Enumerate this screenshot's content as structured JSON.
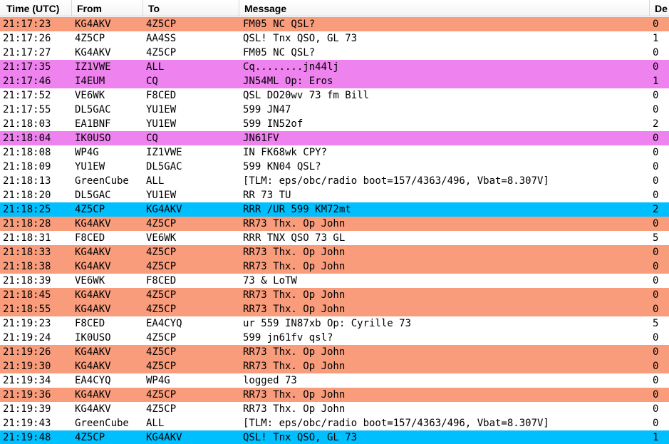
{
  "columns": [
    "Time (UTC)",
    "From",
    "To",
    "Message",
    "De"
  ],
  "colors": {
    "orange": "#f89c7c",
    "purple": "#ee82ee",
    "blue": "#00bfff",
    "white": "#ffffff"
  },
  "rows": [
    {
      "time": "21:17:23",
      "from": "KG4AKV",
      "to": "4Z5CP",
      "message": "FM05 NC QSL?",
      "de": "0",
      "color": "orange"
    },
    {
      "time": "21:17:26",
      "from": "4Z5CP",
      "to": "AA4SS",
      "message": "QSL! Tnx QSO, GL 73",
      "de": "1",
      "color": "white"
    },
    {
      "time": "21:17:27",
      "from": "KG4AKV",
      "to": "4Z5CP",
      "message": "FM05 NC QSL?",
      "de": "0",
      "color": "white"
    },
    {
      "time": "21:17:35",
      "from": "IZ1VWE",
      "to": "ALL",
      "message": "Cq........jn44lj",
      "de": "0",
      "color": "purple"
    },
    {
      "time": "21:17:46",
      "from": "I4EUM",
      "to": "CQ",
      "message": "JN54ML Op: Eros",
      "de": "1",
      "color": "purple"
    },
    {
      "time": "21:17:52",
      "from": "VE6WK",
      "to": "F8CED",
      "message": "QSL DO20wv 73 fm Bill",
      "de": "0",
      "color": "white"
    },
    {
      "time": "21:17:55",
      "from": "DL5GAC",
      "to": "YU1EW",
      "message": "599 JN47",
      "de": "0",
      "color": "white"
    },
    {
      "time": "21:18:03",
      "from": "EA1BNF",
      "to": "YU1EW",
      "message": "599  IN52of",
      "de": "2",
      "color": "white"
    },
    {
      "time": "21:18:04",
      "from": "IK0USO",
      "to": "CQ",
      "message": "JN61FV",
      "de": "0",
      "color": "purple"
    },
    {
      "time": "21:18:08",
      "from": "WP4G",
      "to": "IZ1VWE",
      "message": "IN FK68wk CPY?",
      "de": "0",
      "color": "white"
    },
    {
      "time": "21:18:09",
      "from": "YU1EW",
      "to": "DL5GAC",
      "message": "599 KN04 QSL?",
      "de": "0",
      "color": "white"
    },
    {
      "time": "21:18:13",
      "from": "GreenCube",
      "to": "ALL",
      "message": "[TLM: eps/obc/radio boot=157/4363/496, Vbat=8.307V]",
      "de": "0",
      "color": "white"
    },
    {
      "time": "21:18:20",
      "from": "DL5GAC",
      "to": "YU1EW",
      "message": "RR 73 TU",
      "de": "0",
      "color": "white"
    },
    {
      "time": "21:18:25",
      "from": "4Z5CP",
      "to": "KG4AKV",
      "message": "RRR /UR 599 KM72mt",
      "de": "2",
      "color": "blue"
    },
    {
      "time": "21:18:28",
      "from": "KG4AKV",
      "to": "4Z5CP",
      "message": "RR73 Thx. Op John",
      "de": "0",
      "color": "orange"
    },
    {
      "time": "21:18:31",
      "from": "F8CED",
      "to": "VE6WK",
      "message": "RRR TNX QSO 73 GL",
      "de": "5",
      "color": "white"
    },
    {
      "time": "21:18:33",
      "from": "KG4AKV",
      "to": "4Z5CP",
      "message": "RR73 Thx. Op John",
      "de": "0",
      "color": "orange"
    },
    {
      "time": "21:18:38",
      "from": "KG4AKV",
      "to": "4Z5CP",
      "message": "RR73 Thx. Op John",
      "de": "0",
      "color": "orange"
    },
    {
      "time": "21:18:39",
      "from": "VE6WK",
      "to": "F8CED",
      "message": "73 & LoTW",
      "de": "0",
      "color": "white"
    },
    {
      "time": "21:18:45",
      "from": "KG4AKV",
      "to": "4Z5CP",
      "message": "RR73 Thx. Op John",
      "de": "0",
      "color": "orange"
    },
    {
      "time": "21:18:55",
      "from": "KG4AKV",
      "to": "4Z5CP",
      "message": "RR73 Thx. Op John",
      "de": "0",
      "color": "orange"
    },
    {
      "time": "21:19:23",
      "from": "F8CED",
      "to": "EA4CYQ",
      "message": "ur 559 IN87xb Op: Cyrille 73",
      "de": "5",
      "color": "white"
    },
    {
      "time": "21:19:24",
      "from": "IK0USO",
      "to": "4Z5CP",
      "message": "599 jn61fv qsl?",
      "de": "0",
      "color": "white"
    },
    {
      "time": "21:19:26",
      "from": "KG4AKV",
      "to": "4Z5CP",
      "message": "RR73 Thx. Op John",
      "de": "0",
      "color": "orange"
    },
    {
      "time": "21:19:30",
      "from": "KG4AKV",
      "to": "4Z5CP",
      "message": "RR73 Thx. Op John",
      "de": "0",
      "color": "orange"
    },
    {
      "time": "21:19:34",
      "from": "EA4CYQ",
      "to": "WP4G",
      "message": "logged 73",
      "de": "0",
      "color": "white"
    },
    {
      "time": "21:19:36",
      "from": "KG4AKV",
      "to": "4Z5CP",
      "message": "RR73 Thx. Op John",
      "de": "0",
      "color": "orange"
    },
    {
      "time": "21:19:39",
      "from": "KG4AKV",
      "to": "4Z5CP",
      "message": "RR73 Thx. Op John",
      "de": "0",
      "color": "white"
    },
    {
      "time": "21:19:43",
      "from": "GreenCube",
      "to": "ALL",
      "message": "[TLM: eps/obc/radio boot=157/4363/496, Vbat=8.307V]",
      "de": "0",
      "color": "white"
    },
    {
      "time": "21:19:48",
      "from": "4Z5CP",
      "to": "KG4AKV",
      "message": "QSL! Tnx QSO, GL 73",
      "de": "1",
      "color": "blue"
    }
  ]
}
